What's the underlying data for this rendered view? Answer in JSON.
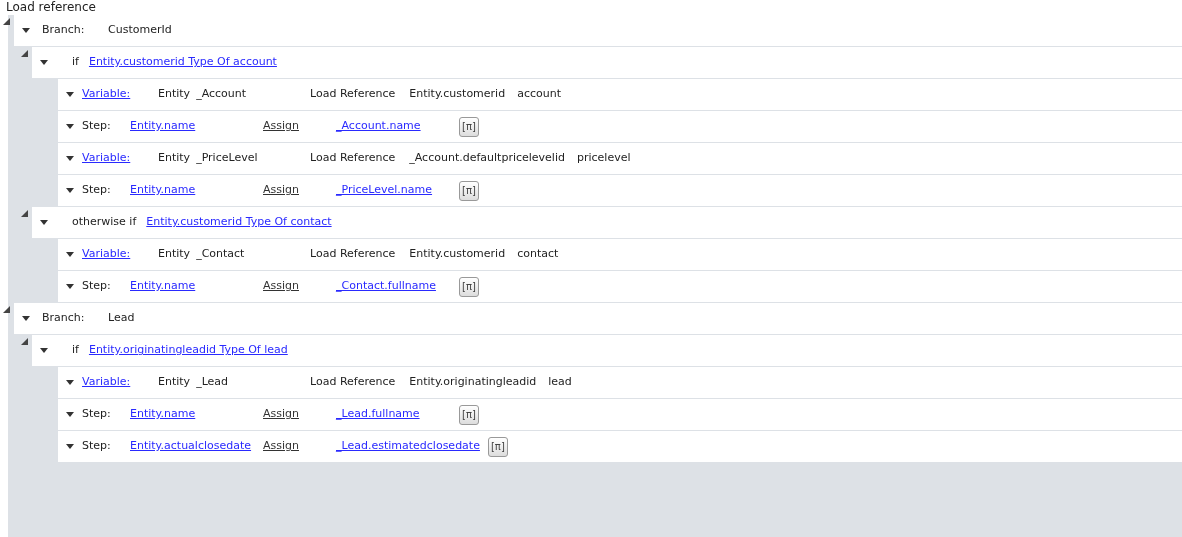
{
  "title": "Load reference",
  "tree": [
    {
      "kind": "branch",
      "expanded": true,
      "label": "Branch:",
      "value": "CustomerId",
      "children": [
        {
          "kind": "condition",
          "expanded": true,
          "keyword": "if",
          "expression": "Entity.customerid Type Of account",
          "children": [
            {
              "kind": "variable",
              "label": "Variable:",
              "type": "Entity",
              "name": "_Account",
              "operation": "Load Reference",
              "source": "Entity.customerid",
              "target": "account"
            },
            {
              "kind": "step",
              "label": "Step:",
              "field": "Entity.name",
              "operation": "Assign",
              "value": "_Account.name",
              "button": "[π]"
            },
            {
              "kind": "variable",
              "label": "Variable:",
              "type": "Entity",
              "name": "_PriceLevel",
              "operation": "Load Reference",
              "source": "_Account.defaultpricelevelid",
              "target": "pricelevel"
            },
            {
              "kind": "step",
              "label": "Step:",
              "field": "Entity.name",
              "operation": "Assign",
              "value": "_PriceLevel.name",
              "button": "[π]"
            }
          ]
        },
        {
          "kind": "condition",
          "expanded": true,
          "keyword": "otherwise if",
          "expression": "Entity.customerid Type Of contact",
          "children": [
            {
              "kind": "variable",
              "label": "Variable:",
              "type": "Entity",
              "name": "_Contact",
              "operation": "Load Reference",
              "source": "Entity.customerid",
              "target": "contact"
            },
            {
              "kind": "step",
              "label": "Step:",
              "field": "Entity.name",
              "operation": "Assign",
              "value": "_Contact.fullname",
              "button": "[π]"
            }
          ]
        }
      ]
    },
    {
      "kind": "branch",
      "expanded": true,
      "label": "Branch:",
      "value": "Lead",
      "children": [
        {
          "kind": "condition",
          "expanded": true,
          "keyword": "if",
          "expression": "Entity.originatingleadid Type Of lead",
          "children": [
            {
              "kind": "variable",
              "label": "Variable:",
              "type": "Entity",
              "name": "_Lead",
              "operation": "Load Reference",
              "source": "Entity.originatingleadid",
              "target": "lead"
            },
            {
              "kind": "step",
              "label": "Step:",
              "field": "Entity.name",
              "operation": "Assign",
              "value": "_Lead.fullname",
              "button": "[π]"
            },
            {
              "kind": "step",
              "label": "Step:",
              "field": "Entity.actualclosedate",
              "operation": "Assign",
              "value": "_Lead.estimatedclosedate",
              "button": "[π]"
            }
          ]
        }
      ]
    }
  ]
}
